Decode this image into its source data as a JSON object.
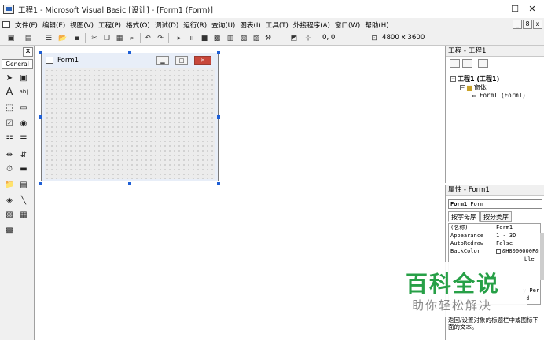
{
  "window": {
    "title": "工程1 - Microsoft Visual Basic [设计] - [Form1 (Form)]",
    "controls": {
      "minimize": "−",
      "maximize": "☐",
      "close": "✕"
    }
  },
  "menu": {
    "items": [
      "文件(F)",
      "编辑(E)",
      "视图(V)",
      "工程(P)",
      "格式(O)",
      "调试(D)",
      "运行(R)",
      "查询(U)",
      "图表(I)",
      "工具(T)",
      "外接程序(A)",
      "窗口(W)",
      "帮助(H)"
    ],
    "mdi_controls": [
      "_",
      "8",
      "x"
    ]
  },
  "toolbar": {
    "position": "0, 0",
    "size": "4800 x 3600"
  },
  "toolbox": {
    "close_label": "✕",
    "tab_label": "General",
    "label_tool_glyph": "A",
    "textbox_tool_glyph": "ab|"
  },
  "form": {
    "title": "Form1"
  },
  "project": {
    "title": "工程 - 工程1",
    "root": "工程1 (工程1)",
    "folder": "窗体",
    "item": "Form1 (Form1)"
  },
  "properties": {
    "title": "属性 - Form1",
    "object_name": "Form1",
    "object_type": "Form",
    "tabs": [
      "按字母序",
      "按分类序"
    ],
    "rows": [
      {
        "name": "(名称)",
        "value": "Form1"
      },
      {
        "name": "Appearance",
        "value": "1 - 3D"
      },
      {
        "name": "AutoRedraw",
        "value": "False"
      },
      {
        "name": "BackColor",
        "value": "&H8000000F&"
      }
    ],
    "partial_values": [
      "ble",
      "y Per",
      "d"
    ],
    "description": "返回/设置对象的标题栏中或图标下面的文本。"
  },
  "watermark": {
    "main": "百科全说",
    "sub": "助你轻松解决"
  },
  "colors": {
    "watermark_green": "#27a047",
    "form_close_red": "#c8473b",
    "selection_handle": "#1e5fd6"
  }
}
